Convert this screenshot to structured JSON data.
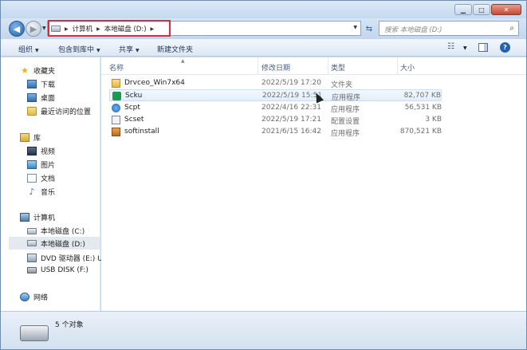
{
  "address": {
    "crumbs": [
      "计算机",
      "本地磁盘 (D:)"
    ]
  },
  "search": {
    "placeholder": "搜索 本地磁盘 (D:)"
  },
  "toolbar": {
    "organize": "组织",
    "include_library": "包含到库中",
    "share": "共享",
    "new_folder": "新建文件夹"
  },
  "sidebar": {
    "favorites": "收藏夹",
    "downloads": "下载",
    "desktop": "桌面",
    "recent": "最近访问的位置",
    "libraries": "库",
    "videos": "视频",
    "pictures": "图片",
    "documents": "文档",
    "music": "音乐",
    "computer": "计算机",
    "drive_c": "本地磁盘 (C:)",
    "drive_d": "本地磁盘 (D:)",
    "drive_e": "DVD 驱动器 (E:) Us",
    "drive_f": "USB DISK (F:)",
    "network": "网络"
  },
  "columns": {
    "name": "名称",
    "date": "修改日期",
    "type": "类型",
    "size": "大小"
  },
  "files": [
    {
      "name": "Drvceo_Win7x64",
      "date": "2022/5/19 17:20",
      "type": "文件夹",
      "size": "",
      "icon": "folder-icon"
    },
    {
      "name": "Scku",
      "date": "2022/5/19 15:51",
      "type": "应用程序",
      "size": "82,707 KB",
      "icon": "app-icon"
    },
    {
      "name": "Scpt",
      "date": "2022/4/16 22:31",
      "type": "应用程序",
      "size": "56,531 KB",
      "icon": "app-icon"
    },
    {
      "name": "Scset",
      "date": "2022/5/19 17:21",
      "type": "配置设置",
      "size": "3 KB",
      "icon": "settings-file-icon"
    },
    {
      "name": "softinstall",
      "date": "2021/6/15 16:42",
      "type": "应用程序",
      "size": "870,521 KB",
      "icon": "installer-icon"
    }
  ],
  "status": {
    "count": "5 个对象"
  }
}
